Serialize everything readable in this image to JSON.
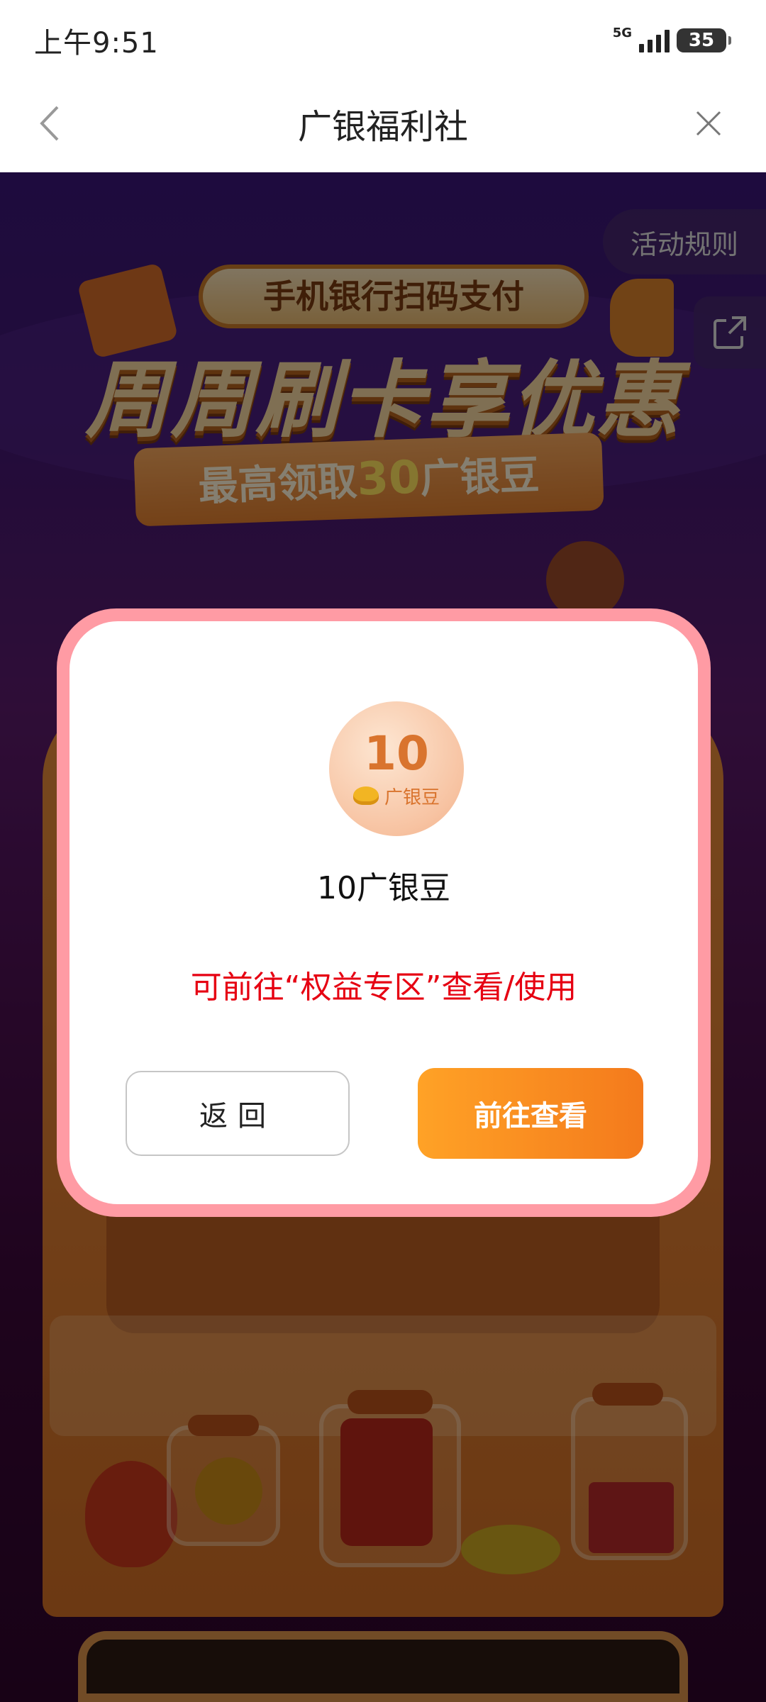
{
  "status_bar": {
    "time": "上午9:51",
    "network": "5G",
    "battery": "35"
  },
  "nav": {
    "title": "广银福利社",
    "back_icon": "chevron-left-icon",
    "close_icon": "close-icon"
  },
  "background": {
    "rules_label": "活动规则",
    "share_icon": "share-icon",
    "banner_subtitle": "手机银行扫码支付",
    "banner_title": "周周刷卡享优惠",
    "ribbon_prefix": "最高领取",
    "ribbon_number": "30",
    "ribbon_suffix": "广银豆"
  },
  "dialog": {
    "reward_number": "10",
    "reward_unit": "广银豆",
    "reward_title": "10广银豆",
    "hint": "可前往“权益专区”查看/使用",
    "back_button": "返回",
    "go_button": "前往查看"
  },
  "colors": {
    "accent_orange": "#f47a1c",
    "hint_red": "#e60012",
    "dialog_border": "#ff9ba4"
  }
}
